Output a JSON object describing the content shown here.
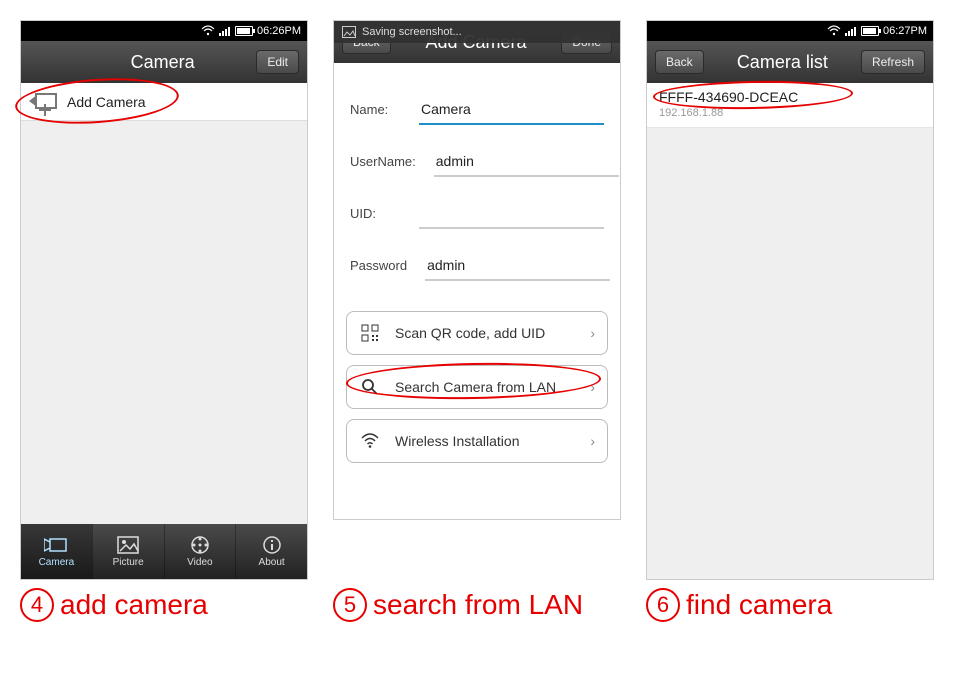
{
  "phone1": {
    "status": {
      "time": "06:26PM"
    },
    "header": {
      "title": "Camera",
      "right_button": "Edit"
    },
    "add_camera_label": "Add Camera",
    "nav": {
      "items": [
        {
          "label": "Camera"
        },
        {
          "label": "Picture"
        },
        {
          "label": "Video"
        },
        {
          "label": "About"
        }
      ]
    }
  },
  "phone2": {
    "toast": "Saving screenshot...",
    "header": {
      "back": "Back",
      "title": "Add Camera",
      "done": "Done"
    },
    "form": {
      "name_label": "Name:",
      "name_value": "Camera",
      "username_label": "UserName:",
      "username_value": "admin",
      "uid_label": "UID:",
      "uid_value": "",
      "password_label": "Password",
      "password_value": "admin"
    },
    "actions": {
      "scan_qr": "Scan QR code, add UID",
      "search_lan": "Search Camera from LAN",
      "wireless": "Wireless Installation"
    }
  },
  "phone3": {
    "status": {
      "time": "06:27PM"
    },
    "header": {
      "back": "Back",
      "title": "Camera list",
      "refresh": "Refresh"
    },
    "item": {
      "uid": "FFFF-434690-DCEAC",
      "ip": "192.168.1.88"
    }
  },
  "captions": {
    "c4_num": "4",
    "c4_text": "add camera",
    "c5_num": "5",
    "c5_text": "search from LAN",
    "c6_num": "6",
    "c6_text": "find camera"
  }
}
